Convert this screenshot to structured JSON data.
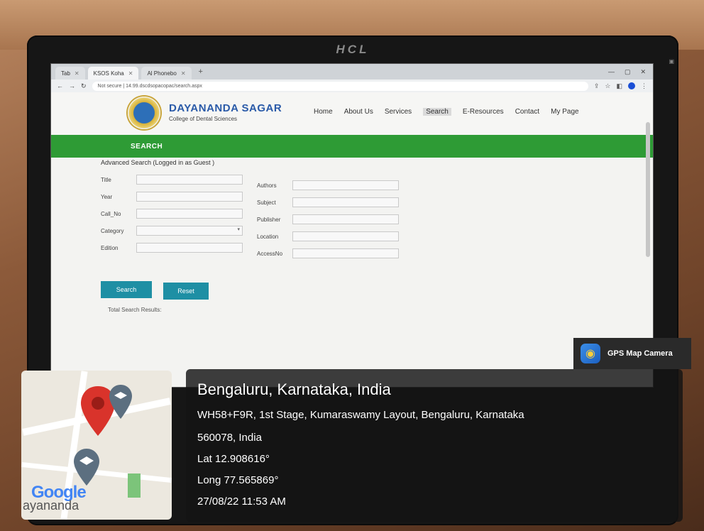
{
  "monitor": {
    "brand": "HCL"
  },
  "browser": {
    "tabs": [
      {
        "label": "Tab"
      },
      {
        "label": "KSOS Koha"
      },
      {
        "label": "Al Phonebo"
      }
    ],
    "url": "Not secure | 14.99.dscdsopacopac/search.aspx"
  },
  "site": {
    "logo_title": "DAYANANDA SAGAR",
    "logo_subtitle": "College of Dental Sciences",
    "nav": [
      "Home",
      "About Us",
      "Services",
      "Search",
      "E-Resources",
      "Contact",
      "My Page"
    ],
    "active_nav": "Search",
    "section_title": "SEARCH",
    "advanced_label": "Advanced Search (Logged in as Guest )"
  },
  "form": {
    "left_fields": [
      "Title",
      "Year",
      "Call_No",
      "Category",
      "Edition"
    ],
    "right_fields": [
      "Authors",
      "Subject",
      "Publisher",
      "Location",
      "AccessNo"
    ],
    "search_button": "Search",
    "reset_button": "Reset",
    "total_results": "Total Search Results:"
  },
  "gps_badge": {
    "label": "GPS Map Camera"
  },
  "location": {
    "city": "Bengaluru, Karnataka, India",
    "address_line1": "WH58+F9R, 1st Stage, Kumaraswamy Layout, Bengaluru, Karnataka",
    "address_line2": "560078, India",
    "lat": "Lat 12.908616°",
    "long": "Long 77.565869°",
    "datetime": "27/08/22 11:53 AM"
  },
  "map": {
    "brand": "Google",
    "under_text": "ayanandа"
  },
  "colors": {
    "green_bar": "#2e9b35",
    "button": "#1e8fa4",
    "logo_blue": "#2a5aa8"
  }
}
